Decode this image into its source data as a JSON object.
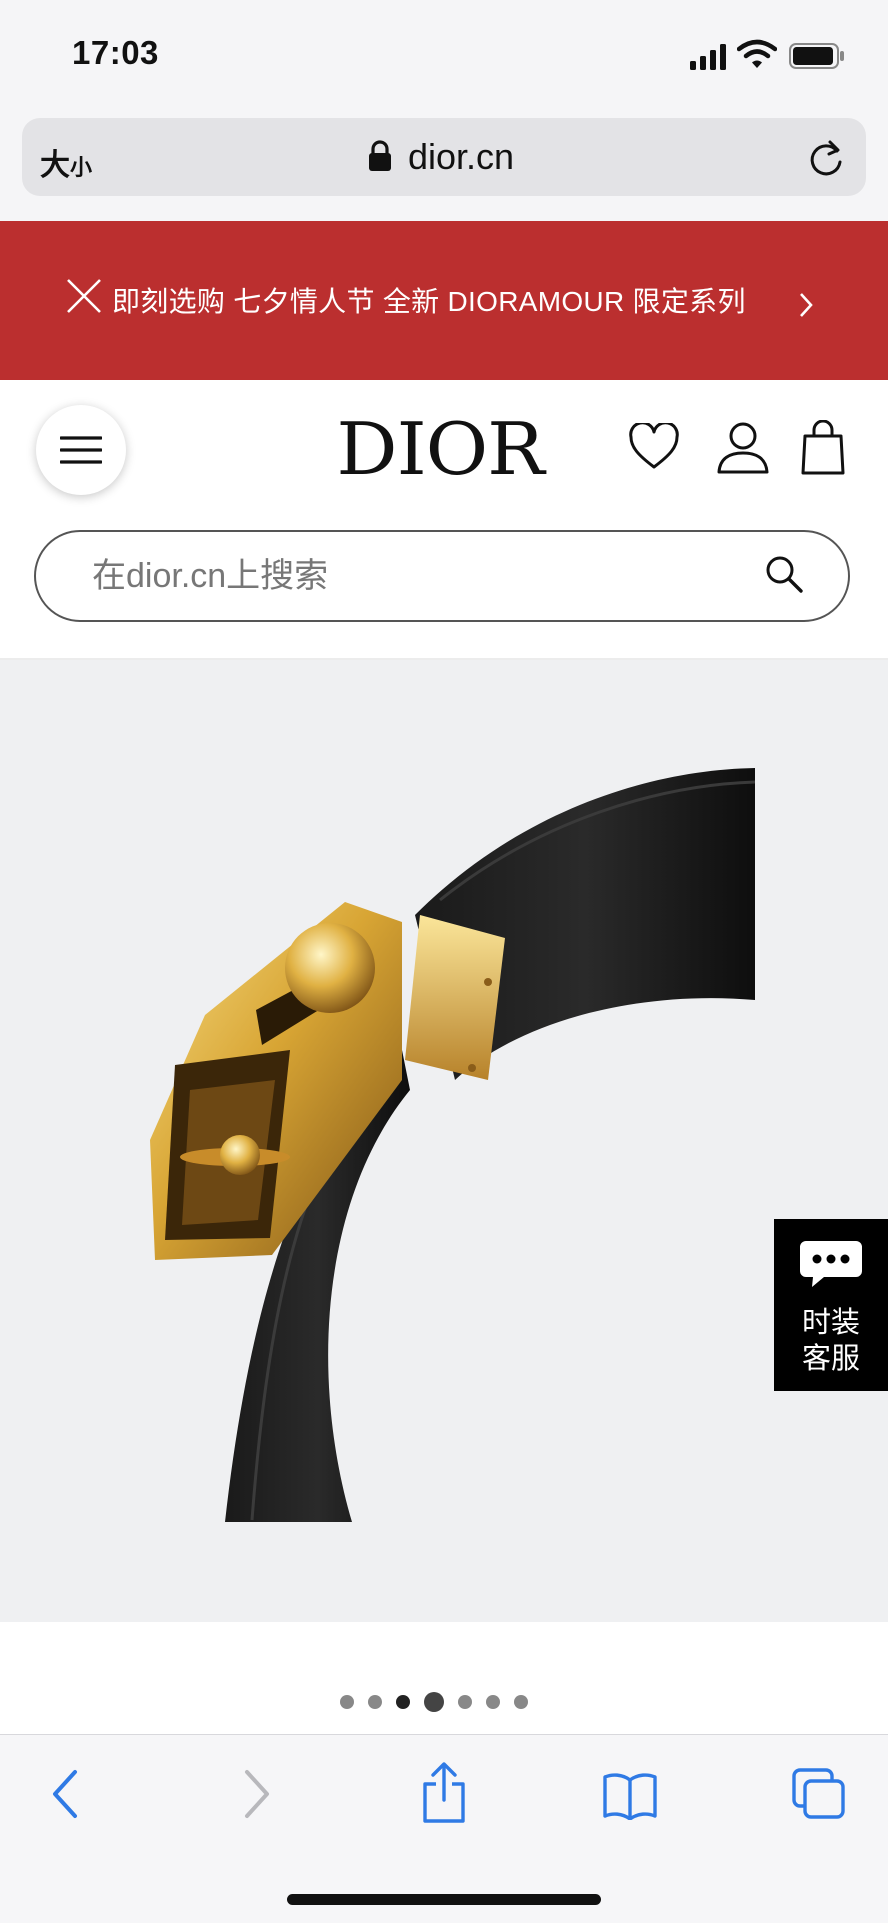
{
  "status_bar": {
    "time": "17:03"
  },
  "browser": {
    "text_size_label_big": "大",
    "text_size_label_small": "小",
    "url": "dior.cn"
  },
  "promo": {
    "text": "即刻选购 七夕情人节 全新 DIORAMOUR 限定系列"
  },
  "header": {
    "logo": "DIOR"
  },
  "search": {
    "placeholder": "在dior.cn上搜索"
  },
  "chat": {
    "line1": "时装",
    "line2": "客服"
  },
  "carousel": {
    "total": 7,
    "active_index": 3
  },
  "colors": {
    "promo_bg": "#bb2f2f",
    "toolbar_accent": "#2f7ae5",
    "gallery_bg": "#eff0f2"
  }
}
